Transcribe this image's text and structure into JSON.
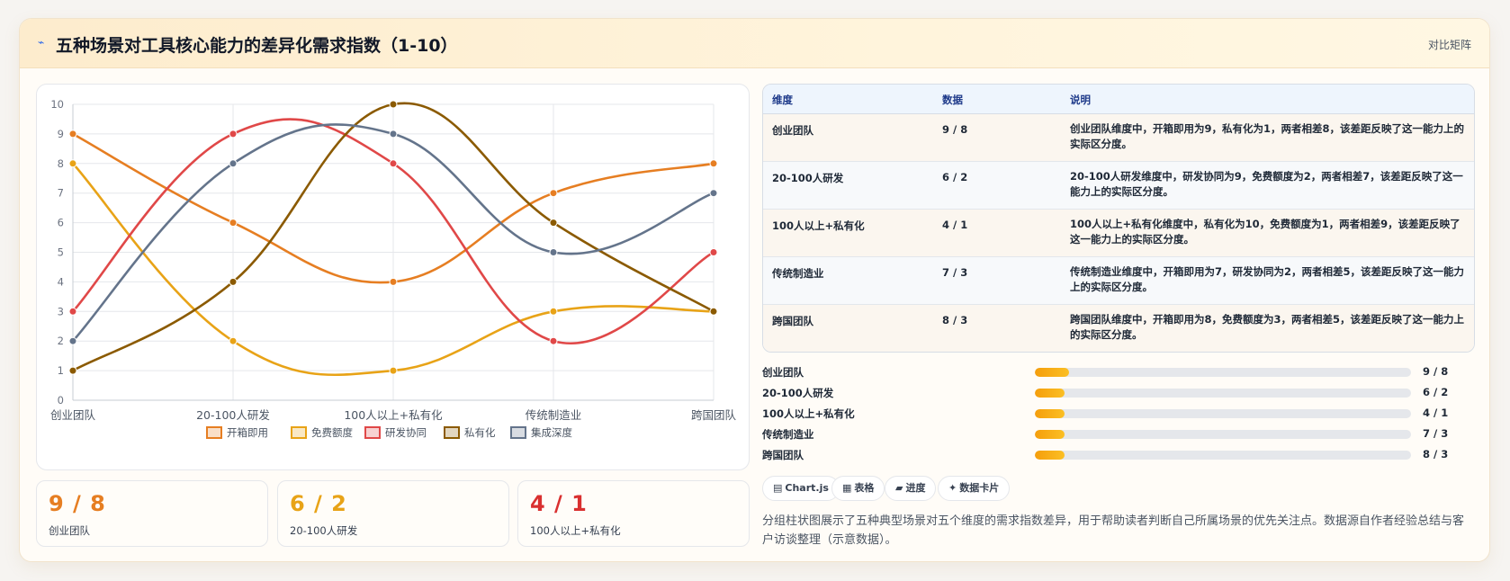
{
  "header": {
    "icon": "lightning-icon",
    "title": "五种场景对工具核心能力的差异化需求指数（1-10）",
    "badge": "对比矩阵"
  },
  "chart_data": {
    "type": "line",
    "categories": [
      "创业团队",
      "20-100人研发",
      "100人以上+私有化",
      "传统制造业",
      "跨国团队"
    ],
    "ylim": [
      0,
      10
    ],
    "yticks": [
      0,
      1,
      2,
      3,
      4,
      5,
      6,
      7,
      8,
      9,
      10
    ],
    "grid": true,
    "legend_position": "bottom",
    "series": [
      {
        "name": "开箱即用",
        "color": "#e67e22",
        "values": [
          9,
          6,
          4,
          7,
          8
        ]
      },
      {
        "name": "免费额度",
        "color": "#e8a317",
        "values": [
          8,
          2,
          1,
          3,
          3
        ]
      },
      {
        "name": "研发协同",
        "color": "#e04848",
        "values": [
          3,
          9,
          8,
          2,
          5
        ]
      },
      {
        "name": "私有化",
        "color": "#8b5a00",
        "values": [
          1,
          4,
          10,
          6,
          3
        ]
      },
      {
        "name": "集成深度",
        "color": "#64748b",
        "values": [
          2,
          8,
          9,
          5,
          7
        ]
      }
    ]
  },
  "stats": [
    {
      "value": "9 / 8",
      "label": "创业团队",
      "color": "#e67e22"
    },
    {
      "value": "6 / 2",
      "label": "20-100人研发",
      "color": "#e8a317"
    },
    {
      "value": "4 / 1",
      "label": "100人以上+私有化",
      "color": "#d93030"
    }
  ],
  "table": {
    "headers": [
      "维度",
      "数据",
      "说明"
    ],
    "rows": [
      {
        "dim": "创业团队",
        "data": "9 / 8",
        "desc": "创业团队维度中，开箱即用为9，私有化为1，两者相差8，该差距反映了这一能力上的实际区分度。"
      },
      {
        "dim": "20-100人研发",
        "data": "6 / 2",
        "desc": "20-100人研发维度中，研发协同为9，免费额度为2，两者相差7，该差距反映了这一能力上的实际区分度。"
      },
      {
        "dim": "100人以上+私有化",
        "data": "4 / 1",
        "desc": "100人以上+私有化维度中，私有化为10，免费额度为1，两者相差9，该差距反映了这一能力上的实际区分度。"
      },
      {
        "dim": "传统制造业",
        "data": "7 / 3",
        "desc": "传统制造业维度中，开箱即用为7，研发协同为2，两者相差5，该差距反映了这一能力上的实际区分度。"
      },
      {
        "dim": "跨国团队",
        "data": "8 / 3",
        "desc": "跨国团队维度中，开箱即用为8，免费额度为3，两者相差5，该差距反映了这一能力上的实际区分度。"
      }
    ]
  },
  "progress": [
    {
      "label": "创业团队",
      "value": "9 / 8",
      "fraction": 0.09
    },
    {
      "label": "20-100人研发",
      "value": "6 / 2",
      "fraction": 0.08
    },
    {
      "label": "100人以上+私有化",
      "value": "4 / 1",
      "fraction": 0.08
    },
    {
      "label": "传统制造业",
      "value": "7 / 3",
      "fraction": 0.08
    },
    {
      "label": "跨国团队",
      "value": "8 / 3",
      "fraction": 0.08
    }
  ],
  "tags": [
    {
      "icon": "chart-icon",
      "glyph": "▤",
      "label": "Chart.js"
    },
    {
      "icon": "table-icon",
      "glyph": "▦",
      "label": "表格"
    },
    {
      "icon": "progress-icon",
      "glyph": "▰",
      "label": "进度"
    },
    {
      "icon": "card-icon",
      "glyph": "✦",
      "label": "数据卡片"
    }
  ],
  "description": "分组柱状图展示了五种典型场景对五个维度的需求指数差异，用于帮助读者判断自己所属场景的优先关注点。数据源自作者经验总结与客户访谈整理（示意数据）。"
}
